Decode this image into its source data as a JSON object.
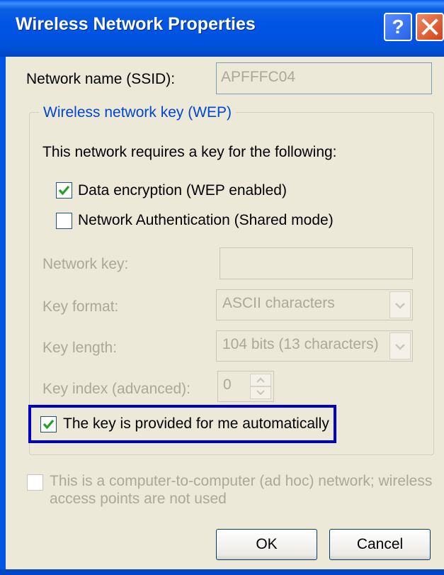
{
  "dialog": {
    "title": "Wireless Network Properties",
    "help_glyph": "?",
    "ssid_label": "Network name (SSID):",
    "ssid_value": "APFFFC04",
    "group_title": "Wireless network key (WEP)",
    "requires_text": "This network requires a key for the following:",
    "data_encryption_label": "Data encryption (WEP enabled)",
    "data_encryption_checked": true,
    "network_auth_label": "Network Authentication (Shared mode)",
    "network_auth_checked": false,
    "network_key_label": "Network key:",
    "network_key_value": "",
    "key_format_label": "Key format:",
    "key_format_value": "ASCII characters",
    "key_length_label": "Key length:",
    "key_length_value": "104 bits (13 characters)",
    "key_index_label": "Key index (advanced):",
    "key_index_value": "0",
    "auto_key_label": "The key is provided for me automatically",
    "auto_key_checked": true,
    "adhoc_line1": "This is a computer-to-computer (ad hoc) network; wireless",
    "adhoc_line2": "access points are not used",
    "adhoc_checked": false,
    "ok_label": "OK",
    "cancel_label": "Cancel"
  },
  "colors": {
    "titlebar": "#0055e5",
    "highlight_border": "#0000cc",
    "disabled_text": "#aca899",
    "group_title": "#0046d5",
    "checkmark": "#21a121"
  }
}
